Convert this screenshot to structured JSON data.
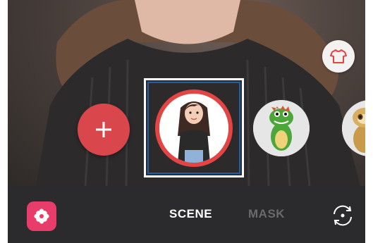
{
  "viewfinder": {
    "add_label": "+",
    "clothing_icon": "tshirt-icon"
  },
  "emoji_list": [
    {
      "name": "my-emoji-girl",
      "selected": true
    },
    {
      "name": "dinosaur-emoji",
      "selected": false
    },
    {
      "name": "sloth-emoji",
      "selected": false
    }
  ],
  "bottom_bar": {
    "stickers_icon": "flower-icon",
    "tabs": [
      {
        "label": "SCENE",
        "active": true
      },
      {
        "label": "MASK",
        "active": false
      }
    ],
    "switch_camera_icon": "switch-camera-icon"
  },
  "colors": {
    "add_button": "#d9474d",
    "selection_ring": "#e34444",
    "selection_box": "#1f5fa8",
    "stickers_button": "#e83c6a",
    "bottom_bar": "#2b2a2c"
  }
}
